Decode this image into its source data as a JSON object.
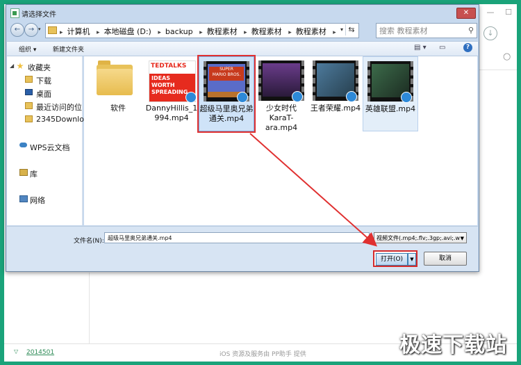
{
  "app": {
    "version": "2014501",
    "footer_text": "iOS 资源及服务由 PP助手 提供",
    "watermark": "极速下载站"
  },
  "dialog": {
    "title": "请选择文件",
    "close_glyph": "✕",
    "address": {
      "crumbs": [
        "计算机",
        "本地磁盘 (D:)",
        "backup",
        "教程素材",
        "教程素材",
        "教程素材"
      ]
    },
    "search_placeholder": "搜索 教程素材",
    "toolbar": {
      "organize": "组织 ▾",
      "new_folder": "新建文件夹"
    },
    "nav": [
      {
        "label": "收藏夹",
        "icon": "star-icon"
      },
      {
        "label": "下载",
        "icon": "folder-icon"
      },
      {
        "label": "桌面",
        "icon": "desktop-icon"
      },
      {
        "label": "最近访问的位",
        "icon": "folder-icon"
      },
      {
        "label": "2345Downlo",
        "icon": "folder-icon"
      },
      {
        "label": "WPS云文档",
        "icon": "cloud-icon"
      },
      {
        "label": "库",
        "icon": "library-icon"
      },
      {
        "label": "网络",
        "icon": "network-icon"
      }
    ],
    "files": [
      {
        "name": "软件",
        "type": "folder"
      },
      {
        "name": "DannyHillis_1994.mp4",
        "type": "video",
        "thumb_text": [
          "TEDTALKS",
          "IDEAS",
          "WORTH",
          "SPREADING"
        ]
      },
      {
        "name": "超级马里奥兄弟通关.mp4",
        "type": "video",
        "thumb_text": [
          "SUPER",
          "MARIO BROS."
        ]
      },
      {
        "name": "少女时代KaraT-ara.mp4",
        "type": "video"
      },
      {
        "name": "王者荣耀.mp4",
        "type": "video"
      },
      {
        "name": "英雄联盟.mp4",
        "type": "video"
      }
    ],
    "filename_label": "文件名(N):",
    "filename_value": "超级马里奥兄弟通关.mp4",
    "filetype": "视频文件(.mp4;.flv;.3gp;.avi;.w",
    "open_label": "打开(O)",
    "cancel_label": "取消"
  },
  "colors": {
    "frame": "#1aa37a",
    "highlight": "#e03030",
    "selection": "#cfe3f8"
  }
}
